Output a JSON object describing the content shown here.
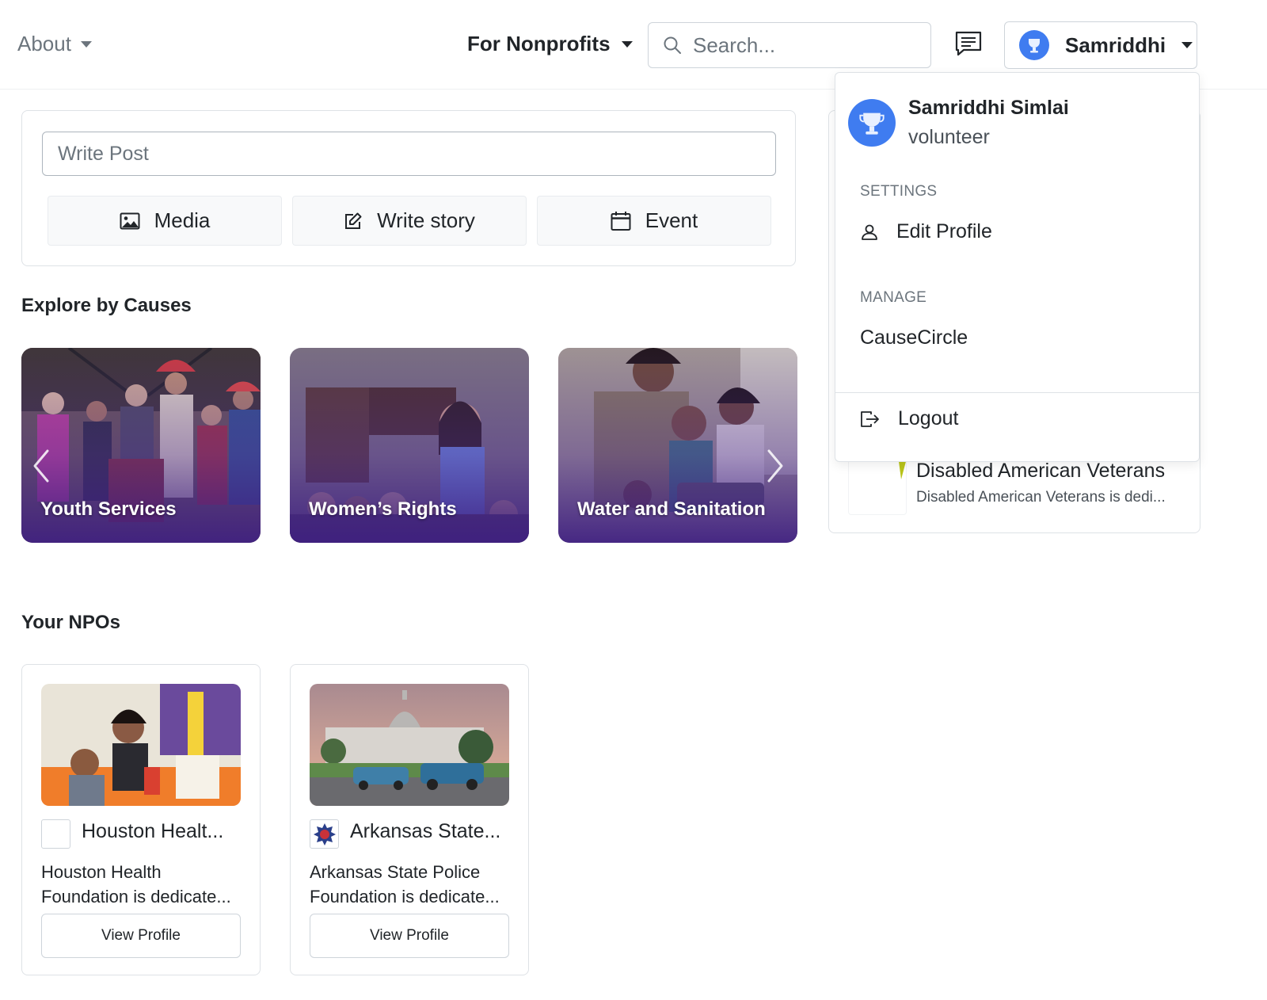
{
  "header": {
    "about_label": "About",
    "nonprofits_label": "For Nonprofits",
    "search_placeholder": "Search...",
    "user_short_name": "Samriddhi"
  },
  "post": {
    "placeholder": "Write Post",
    "actions": [
      {
        "label": "Media",
        "icon": "image-icon"
      },
      {
        "label": "Write story",
        "icon": "edit-icon"
      },
      {
        "label": "Event",
        "icon": "calendar-icon"
      }
    ]
  },
  "causes": {
    "title": "Explore by Causes",
    "items": [
      {
        "label": "Youth Services"
      },
      {
        "label": "Women’s Rights"
      },
      {
        "label": "Water and Sanitation"
      }
    ]
  },
  "npos": {
    "title": "Your NPOs",
    "items": [
      {
        "name": "Houston Healt...",
        "description": "Houston Health Foundation is dedicate...",
        "button": "View Profile"
      },
      {
        "name": "Arkansas State...",
        "description": "Arkansas State Police Foundation is dedicate...",
        "button": "View Profile"
      }
    ]
  },
  "side_card": {
    "name": "Disabled American Veterans",
    "description": "Disabled American Veterans is dedi..."
  },
  "dropdown": {
    "full_name": "Samriddhi Simlai",
    "role": "volunteer",
    "settings_heading": "SETTINGS",
    "edit_profile": "Edit Profile",
    "manage_heading": "MANAGE",
    "causecircle": "CauseCircle",
    "logout": "Logout"
  },
  "colors": {
    "accent_blue": "#3f7cf0",
    "cause_overlay": "#3e1e82"
  }
}
